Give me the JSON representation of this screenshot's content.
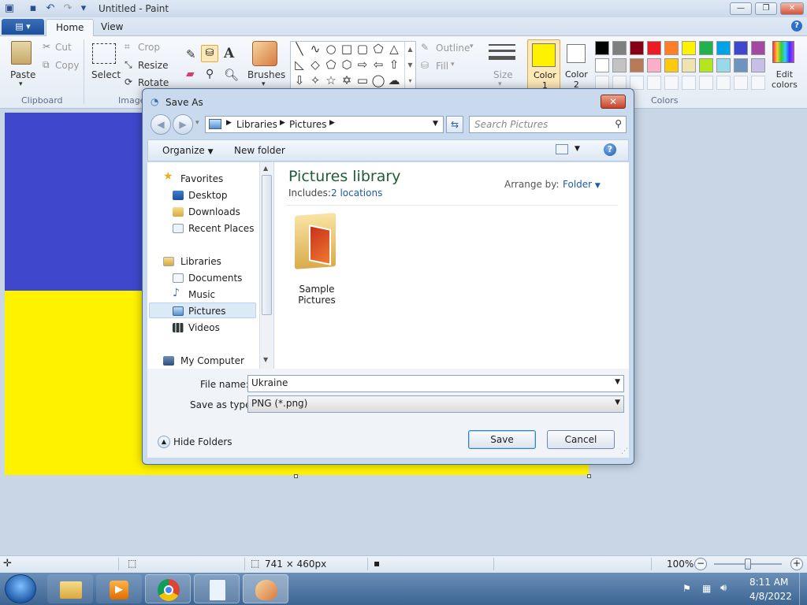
{
  "window": {
    "title": "Untitled - Paint"
  },
  "ribbon": {
    "tabs": [
      "Home",
      "View"
    ],
    "clipboard": {
      "paste": "Paste",
      "cut": "Cut",
      "copy": "Copy",
      "group": "Clipboard"
    },
    "image": {
      "select": "Select",
      "crop": "Crop",
      "resize": "Resize",
      "rotate": "Rotate",
      "group": "Image"
    },
    "brushes": "Brushes",
    "outline": "Outline",
    "fill": "Fill",
    "size": "Size",
    "color1": "Color\n1",
    "color2": "Color\n2",
    "edit_colors": "Edit\ncolors",
    "colors_group": "Colors",
    "palette_row1": [
      "#000000",
      "#7f7f7f",
      "#880015",
      "#ed1c24",
      "#ff7f27",
      "#fff200",
      "#22b14c",
      "#00a2e8",
      "#3f48cc",
      "#a349a4"
    ],
    "palette_row2": [
      "#ffffff",
      "#c3c3c3",
      "#b97a57",
      "#ffaec9",
      "#ffc90e",
      "#efe4b0",
      "#b5e61d",
      "#99d9ea",
      "#7092be",
      "#c8bfe7"
    ],
    "color1_value": "#fff200",
    "color2_value": "#ffffff"
  },
  "canvas": {
    "top_color": "#3f48cc",
    "bottom_color": "#fff200"
  },
  "dialog": {
    "title": "Save As",
    "breadcrumb": [
      "Libraries",
      "Pictures"
    ],
    "search_placeholder": "Search Pictures",
    "organize": "Organize",
    "new_folder": "New folder",
    "nav": {
      "favorites": "Favorites",
      "desktop": "Desktop",
      "downloads": "Downloads",
      "recent_places": "Recent Places",
      "libraries": "Libraries",
      "documents": "Documents",
      "music": "Music",
      "pictures": "Pictures",
      "videos": "Videos",
      "my_computer": "My Computer"
    },
    "library_title": "Pictures library",
    "includes_label": "Includes:",
    "includes_link": "2 locations",
    "arrange_by_label": "Arrange by:",
    "arrange_by_value": "Folder",
    "items": [
      {
        "name": "Sample Pictures"
      }
    ],
    "file_name_label": "File name:",
    "file_name_value": "Ukraine",
    "save_type_label": "Save as type:",
    "save_type_value": "PNG (*.png)",
    "hide_folders": "Hide Folders",
    "save": "Save",
    "cancel": "Cancel"
  },
  "statusbar": {
    "dimensions": "741 × 460px",
    "zoom": "100%"
  },
  "taskbar": {
    "time": "8:11 AM",
    "date": "4/8/2022"
  }
}
